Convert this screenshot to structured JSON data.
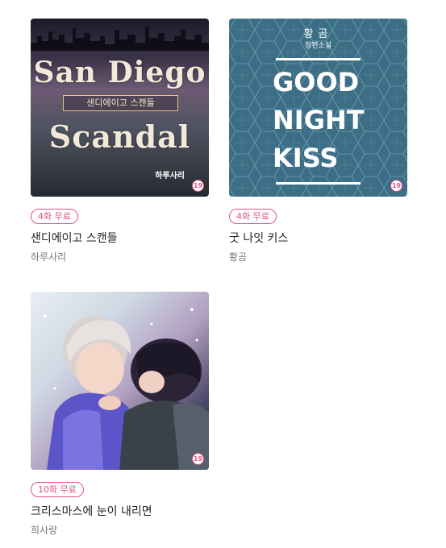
{
  "items": [
    {
      "badge": "4화 무료",
      "title": "샌디에이고 스캔들",
      "author": "하루사리",
      "age_rating": "19",
      "cover": {
        "line_top": "San Diego",
        "subtitle": "샌디에이고 스캔들",
        "line_bottom": "Scandal",
        "pen_name": "하루사리"
      }
    },
    {
      "badge": "4화 무료",
      "title": "굿 나잇 키스",
      "author": "황곰",
      "age_rating": "19",
      "cover": {
        "author": "황곰",
        "genre": "장편소설",
        "lines": [
          "GOOD",
          "NIGHT",
          "KISS"
        ]
      }
    },
    {
      "badge": "10화 무료",
      "title": "크리스마스에 눈이 내리면",
      "author": "희사랑",
      "age_rating": "19"
    }
  ],
  "colors": {
    "badge": "#e0527f",
    "title": "#222222",
    "author": "#777777"
  }
}
